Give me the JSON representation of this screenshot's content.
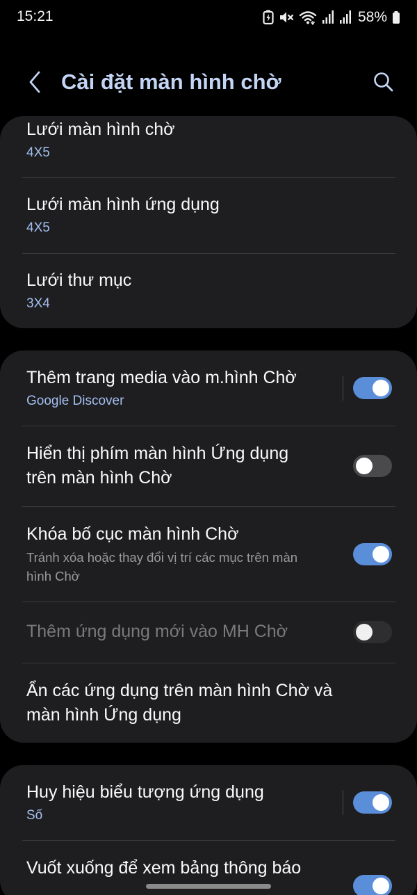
{
  "status_bar": {
    "time": "15:21",
    "battery": "58%",
    "icons": [
      "battery-saver-icon",
      "mute-icon",
      "wifi-icon",
      "signal-icon",
      "signal-icon",
      "battery-icon"
    ]
  },
  "app_bar": {
    "title": "Cài đặt màn hình chờ",
    "icons": [
      "back-icon",
      "search-icon"
    ]
  },
  "grid_card": {
    "items": [
      {
        "title": "Lưới màn hình chờ",
        "value": "4X5"
      },
      {
        "title": "Lưới màn hình ứng dụng",
        "value": "4X5"
      },
      {
        "title": "Lưới thư mục",
        "value": "3X4"
      }
    ]
  },
  "options_card": {
    "items": [
      {
        "title": "Thêm trang media vào m.hình Chờ",
        "subtitle": "Google Discover",
        "toggle": "on"
      },
      {
        "title_line1": "Hiển thị phím màn hình Ứng dụng",
        "title_line2": "trên màn hình Chờ",
        "toggle": "off"
      },
      {
        "title": "Khóa bố cục màn hình Chờ",
        "subtitle_line1": "Tránh xóa hoặc thay đổi vị trí các mục trên màn",
        "subtitle_line2": "hình Chờ",
        "toggle": "on"
      },
      {
        "title": "Thêm ứng dụng mới vào MH Chờ",
        "toggle": "off",
        "disabled": true
      },
      {
        "title_line1": "Ẩn các ứng dụng trên màn hình Chờ và",
        "title_line2": "màn hình Ứng dụng"
      }
    ]
  },
  "badges_card": {
    "items": [
      {
        "title": "Huy hiệu biểu tượng ứng dụng",
        "subtitle": "Số",
        "toggle": "on"
      },
      {
        "title": "Vuốt xuống để xem bảng thông báo",
        "toggle": "on"
      }
    ]
  },
  "colors": {
    "background": "#000000",
    "card": "#1e1e20",
    "accent": "#5b8ed8",
    "title": "#c3d4f5",
    "subtitle": "#a3bff0"
  }
}
